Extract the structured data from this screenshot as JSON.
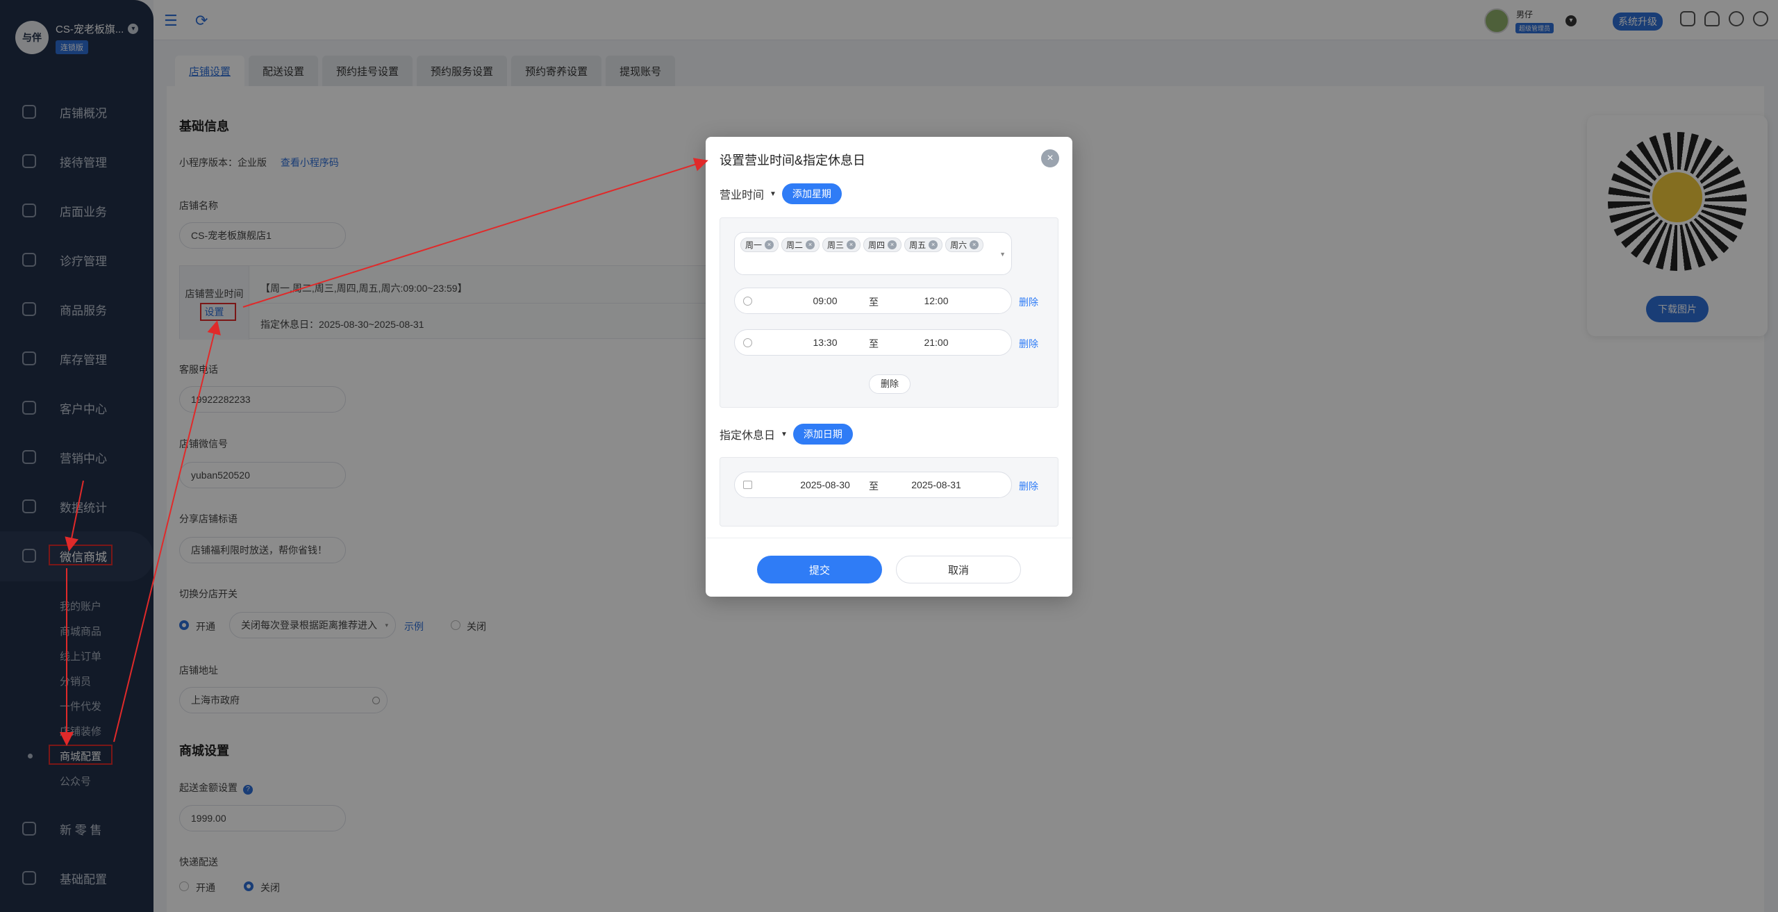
{
  "sidebar": {
    "brand_logo": "与伴",
    "brand_name": "CS-宠老板旗...",
    "brand_badge": "连锁版",
    "items": [
      {
        "label": "店铺概况",
        "icon": "store-overview-icon"
      },
      {
        "label": "接待管理",
        "icon": "reception-icon"
      },
      {
        "label": "店面业务",
        "icon": "shop-business-icon"
      },
      {
        "label": "诊疗管理",
        "icon": "medical-icon"
      },
      {
        "label": "商品服务",
        "icon": "goods-icon"
      },
      {
        "label": "库存管理",
        "icon": "inventory-icon"
      },
      {
        "label": "客户中心",
        "icon": "customer-icon"
      },
      {
        "label": "营销中心",
        "icon": "marketing-icon"
      },
      {
        "label": "数据统计",
        "icon": "stats-icon"
      },
      {
        "label": "微信商城",
        "icon": "wechat-mall-icon"
      }
    ],
    "sub_items": [
      "我的账户",
      "商城商品",
      "线上订单",
      "分销员",
      "一件代发",
      "店铺装修",
      "商城配置",
      "公众号"
    ],
    "bottom_items": [
      {
        "label": "新 零 售",
        "icon": "new-retail-icon"
      },
      {
        "label": "基础配置",
        "icon": "base-config-icon"
      }
    ]
  },
  "topbar": {
    "user_name": "男仔",
    "user_role": "超级管理员",
    "upgrade_label": "系统升级"
  },
  "tabs": [
    "店铺设置",
    "配送设置",
    "预约挂号设置",
    "预约服务设置",
    "预约寄养设置",
    "提现账号"
  ],
  "basic": {
    "title": "基础信息",
    "mini_version_label": "小程序版本：企业版",
    "mini_code_link": "查看小程序码",
    "store_name_label": "店铺名称",
    "store_name": "CS-宠老板旗舰店1",
    "hours_label": "店铺营业时间",
    "hours_set_link": "设置",
    "hours_value": "【周一,周二,周三,周四,周五,周六:09:00~23:59】",
    "rest_value": "指定休息日：2025-08-30~2025-08-31",
    "phone_label": "客服电话",
    "phone": "19922282233",
    "wechat_label": "店铺微信号",
    "wechat": "yuban520520",
    "slogan_label": "分享店铺标语",
    "slogan": "店铺福利限时放送，帮你省钱！",
    "branch_label": "切换分店开关",
    "branch_on": "开通",
    "branch_select": "关闭每次登录根据距离推荐进入",
    "branch_example": "示例",
    "branch_off": "关闭",
    "address_label": "店铺地址",
    "address": "上海市政府"
  },
  "mall": {
    "title": "商城设置",
    "min_amount_label": "起送金额设置",
    "min_amount": "1999.00",
    "express_label": "快递配送",
    "express_on": "开通",
    "express_off": "关闭"
  },
  "qr": {
    "download_label": "下载图片"
  },
  "modal": {
    "title": "设置营业时间&指定休息日",
    "business_label": "营业时间",
    "add_week_label": "添加星期",
    "weekdays": [
      "周一",
      "周二",
      "周三",
      "周四",
      "周五",
      "周六"
    ],
    "ranges": [
      {
        "start": "09:00",
        "to": "至",
        "end": "12:00",
        "delete": "删除"
      },
      {
        "start": "13:30",
        "to": "至",
        "end": "21:00",
        "delete": "删除"
      }
    ],
    "group_delete": "删除",
    "rest_label": "指定休息日",
    "add_date_label": "添加日期",
    "rest_range": {
      "start": "2025-08-30",
      "to": "至",
      "end": "2025-08-31",
      "delete": "删除"
    },
    "submit_label": "提交",
    "cancel_label": "取消"
  },
  "colors": {
    "accent": "#2f7cf6",
    "sidebar": "#22304a",
    "annotation": "#e02a2a"
  }
}
